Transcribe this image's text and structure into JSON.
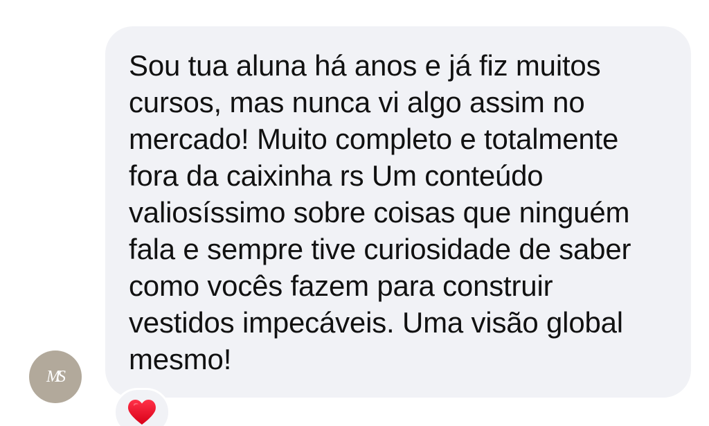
{
  "avatar": {
    "monogram": "MS",
    "background": "#b2a99b"
  },
  "message": {
    "lines": [
      "Sou tua aluna há anos e já fiz muitos",
      "cursos, mas nunca vi algo assim no",
      "mercado! Muito completo e totalmente",
      "fora da caixinha rs Um conteúdo",
      "valiosíssimo sobre coisas que ninguém",
      "fala e sempre tive curiosidade de saber",
      "como vocês fazem para construir",
      "vestidos impecáveis. Uma visão global",
      "mesmo!"
    ],
    "bubble_color": "#f1f2f6"
  },
  "reaction": {
    "icon": "heart-icon",
    "color": "#e0102b"
  }
}
